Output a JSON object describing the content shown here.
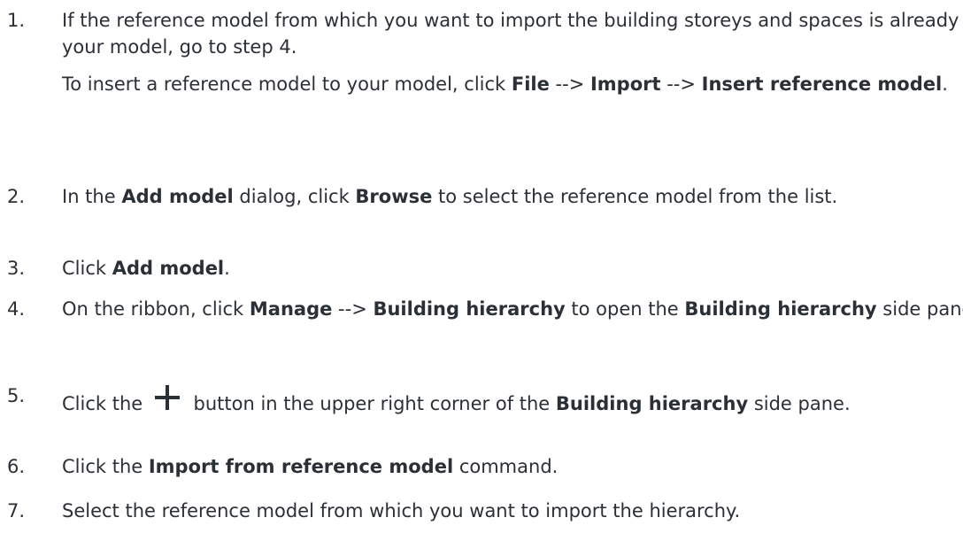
{
  "steps": [
    {
      "number": "1.",
      "p1": {
        "t1": "If the reference model from which you want to import the building storeys and spaces is already in your model, go to step 4."
      },
      "p2": {
        "t1": "To insert a reference model to your model, click ",
        "b1": "File",
        "t2": " --> ",
        "b2": "Import",
        "t3": " --> ",
        "b3": "Insert reference model",
        "t4": "."
      }
    },
    {
      "number": "2.",
      "t1": "In the ",
      "b1": "Add model",
      "t2": " dialog, click ",
      "b2": "Browse",
      "t3": " to select the reference model from the list."
    },
    {
      "number": "3.",
      "t1": "Click ",
      "b1": "Add model",
      "t2": "."
    },
    {
      "number": "4.",
      "t1": "On the ribbon, click ",
      "b1": "Manage",
      "t2": " --> ",
      "b2": "Building hierarchy",
      "t3": " to open the ",
      "b3": "Building hierarchy",
      "t4": " side pane."
    },
    {
      "number": "5.",
      "t1": "Click the ",
      "icon": "plus-icon",
      "t2": " button in the upper right corner of the ",
      "b1": "Building hierarchy",
      "t3": " side pane."
    },
    {
      "number": "6.",
      "t1": "Click the ",
      "b1": "Import from reference model",
      "t2": " command."
    },
    {
      "number": "7.",
      "t1": "Select the reference model from which you want to import the hierarchy."
    }
  ],
  "colors": {
    "text": "#2b2f36",
    "icon": "#2b2f36"
  }
}
